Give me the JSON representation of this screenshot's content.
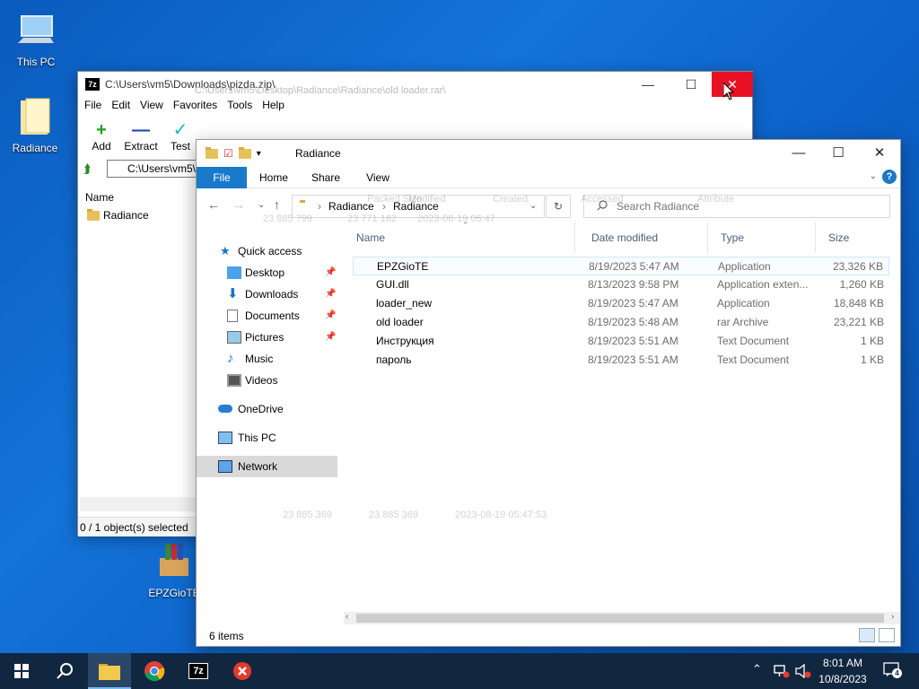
{
  "desktop": {
    "icons": [
      {
        "label": "This PC"
      },
      {
        "label": "Radiance"
      },
      {
        "label": "EPZGioTE"
      }
    ]
  },
  "sevenzip": {
    "title": "C:\\Users\\vm5\\Downloads\\pizda.zip\\",
    "ghost_title": "C:\\Users\\vm5\\Desktop\\Radiance\\Radiance\\old loader.rar\\",
    "logo": "7z",
    "menu": [
      "File",
      "Edit",
      "View",
      "Favorites",
      "Tools",
      "Help"
    ],
    "toolbar": [
      {
        "label": "Add",
        "glyph": "+",
        "color": "#1ca21c"
      },
      {
        "label": "Extract",
        "glyph": "—",
        "color": "#1a3fa8"
      },
      {
        "label": "Test",
        "glyph": "✓",
        "color": "#18b8c8"
      }
    ],
    "address": "C:\\Users\\vm5\\",
    "list_header": "Name",
    "rows": [
      {
        "name": "Radiance"
      }
    ],
    "status": "0 / 1 object(s) selected",
    "ghost_columns": [
      "Size",
      "Packed Size",
      "Modified",
      "Created",
      "Accessed",
      "Attribute"
    ],
    "ghost_values": [
      "23 885 799",
      "23 771 182",
      "2023-08-19 05:47"
    ],
    "ghost_status": [
      "23 885 369",
      "23 885 369",
      "2023-08-19 05:47:53"
    ]
  },
  "explorer": {
    "title": "Radiance",
    "ribbon": {
      "file": "File",
      "home": "Home",
      "share": "Share",
      "view": "View"
    },
    "breadcrumb": [
      "Radiance",
      "Radiance"
    ],
    "search_placeholder": "Search Radiance",
    "nav": {
      "quick_access": "Quick access",
      "desktop": "Desktop",
      "downloads": "Downloads",
      "documents": "Documents",
      "pictures": "Pictures",
      "music": "Music",
      "videos": "Videos",
      "onedrive": "OneDrive",
      "thispc": "This PC",
      "network": "Network"
    },
    "columns": {
      "name": "Name",
      "date": "Date modified",
      "type": "Type",
      "size": "Size"
    },
    "files": [
      {
        "name": "EPZGioTE",
        "date": "8/19/2023 5:47 AM",
        "type": "Application",
        "size": "23,326 KB",
        "icon": "app-icon"
      },
      {
        "name": "GUI.dll",
        "date": "8/13/2023 9:58 PM",
        "type": "Application exten...",
        "size": "1,260 KB",
        "icon": "dll-icon"
      },
      {
        "name": "loader_new",
        "date": "8/19/2023 5:47 AM",
        "type": "Application",
        "size": "18,848 KB",
        "icon": "app-icon"
      },
      {
        "name": "old loader",
        "date": "8/19/2023 5:48 AM",
        "type": "rar Archive",
        "size": "23,221 KB",
        "icon": "rar-icon"
      },
      {
        "name": "Инструкция",
        "date": "8/19/2023 5:51 AM",
        "type": "Text Document",
        "size": "1 KB",
        "icon": "text-icon"
      },
      {
        "name": "пароль",
        "date": "8/19/2023 5:51 AM",
        "type": "Text Document",
        "size": "1 KB",
        "icon": "text-icon"
      }
    ],
    "status": "6 items"
  },
  "taskbar": {
    "time": "8:01 AM",
    "date": "10/8/2023",
    "notifications": "4"
  }
}
